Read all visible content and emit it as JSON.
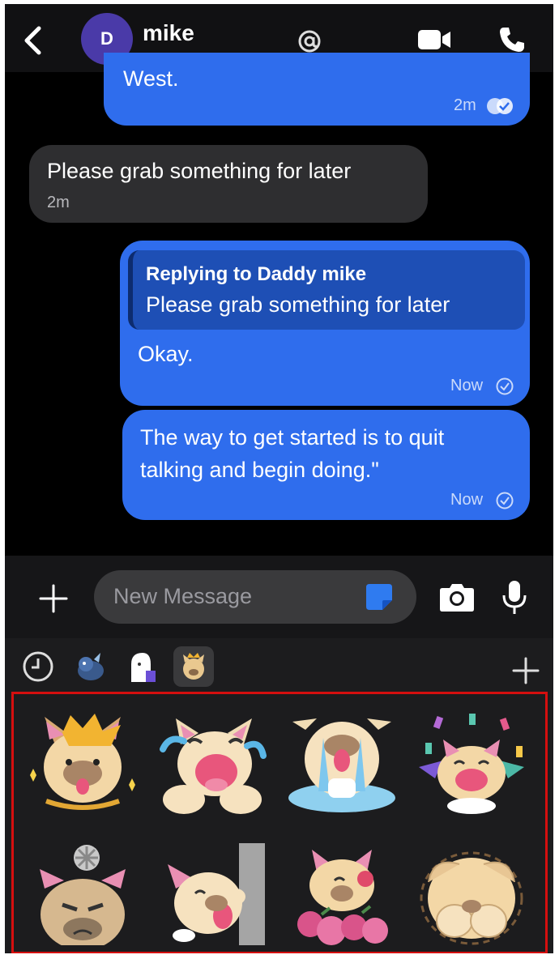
{
  "header": {
    "avatar_initial": "D",
    "contact_name": "mike",
    "icons": [
      "back-chevron-icon",
      "at-mention-icon",
      "video-call-icon",
      "phone-call-icon"
    ]
  },
  "messages": [
    {
      "direction": "outgoing",
      "text": "West.",
      "time": "2m",
      "status": "delivered-double-check"
    },
    {
      "direction": "incoming",
      "text": "Please grab something for later",
      "time": "2m"
    },
    {
      "direction": "outgoing",
      "reply_label": "Replying to Daddy mike",
      "reply_quote": "Please grab something for later",
      "text": "Okay.",
      "time": "Now",
      "status": "sent-check"
    },
    {
      "direction": "outgoing",
      "text_line1": "The way to get started is to quit",
      "text_line2": "talking and begin doing.\"",
      "time": "Now",
      "status": "sent-check"
    }
  ],
  "composer": {
    "placeholder": "New Message",
    "icons": [
      "plus-icon",
      "sticker-icon",
      "camera-icon",
      "microphone-icon"
    ]
  },
  "sticker_tabs": {
    "items": [
      "recent-clock-icon",
      "dragon-pack-icon",
      "ghost-pack-icon",
      "pug-pack-icon"
    ],
    "active": "pug-pack-icon",
    "add_icon": "add-pack-icon"
  },
  "stickers": [
    "pug-crown-sticker",
    "pug-crying-laugh-sticker",
    "pug-crying-puddle-sticker",
    "pug-celebrate-sticker",
    "pug-angry-sticker",
    "pug-peek-sticker",
    "pug-flowers-sticker",
    "pug-hide-face-sticker"
  ],
  "colors": {
    "outgoing_bubble": "#2f6ded",
    "incoming_bubble": "#2e2e30",
    "highlight_border": "#d50f0f"
  }
}
